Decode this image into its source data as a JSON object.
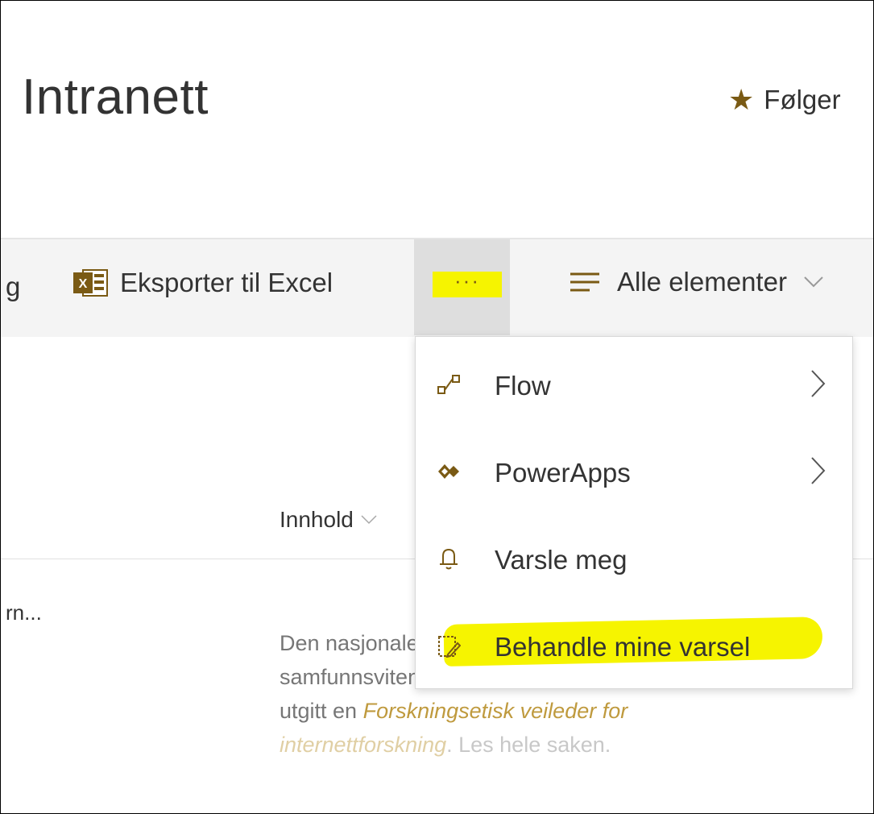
{
  "header": {
    "site_title": "Intranett",
    "follow_label": "Følger"
  },
  "commandbar": {
    "partial_left_label": "g",
    "export_excel_label": "Eksporter til Excel",
    "more_label": "···",
    "view_label": "Alle elementer"
  },
  "menu": {
    "items": [
      {
        "label": "Flow",
        "icon": "flow-icon",
        "has_submenu": true
      },
      {
        "label": "PowerApps",
        "icon": "powerapps-icon",
        "has_submenu": true
      },
      {
        "label": "Varsle meg",
        "icon": "bell-icon",
        "has_submenu": false
      },
      {
        "label": "Behandle mine varsel",
        "icon": "manage-alerts-icon",
        "has_submenu": false,
        "highlighted": true
      }
    ]
  },
  "list": {
    "column_header": "Innhold",
    "row_title": "rn...",
    "body_line1": "Den nasjonale forskningsetiske komité for",
    "body_line2": "samfunnsvitenskap og humaniora (NESH) har",
    "body_line3_prefix": "utgitt en",
    "body_link": "Forskningsetisk veileder for",
    "body_link2": "internettforskning",
    "body_suffix": ". Les hele saken."
  },
  "colors": {
    "accent": "#7a5a14",
    "highlight": "#f6f400",
    "link": "#bf9a3e"
  }
}
